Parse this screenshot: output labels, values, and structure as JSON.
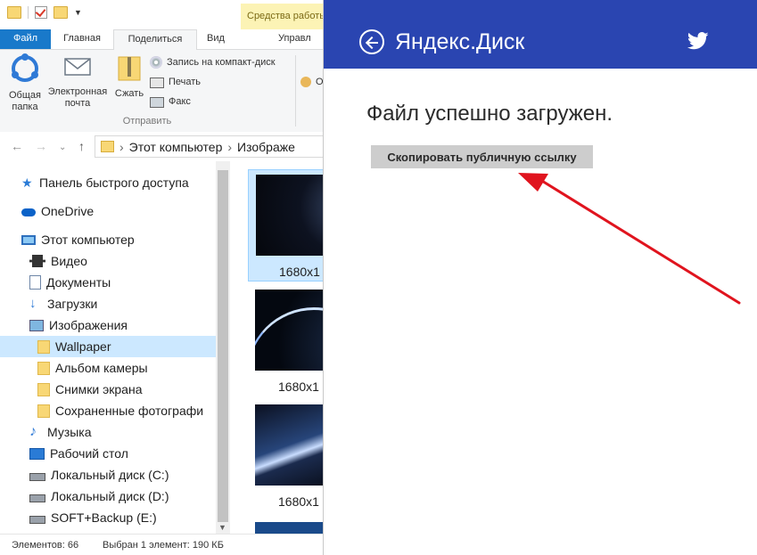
{
  "explorer": {
    "context_tab": "Средства работы",
    "tabs": {
      "file": "Файл",
      "home": "Главная",
      "share": "Поделиться",
      "view": "Вид",
      "manage": "Управл"
    },
    "ribbon": {
      "share_folder": "Общая папка",
      "email": "Электронная почта",
      "zip": "Сжать",
      "burn": "Запись на компакт-диск",
      "print": "Печать",
      "fax": "Факс",
      "group_label": "Отправить",
      "cut_label": "О"
    },
    "address": {
      "part1": "Этот компьютер",
      "sep": "›",
      "part2": "Изображе"
    },
    "tree": [
      "Панель быстрого доступа",
      "OneDrive",
      "Этот компьютер",
      "Видео",
      "Документы",
      "Загрузки",
      "Изображения",
      "Wallpaper",
      "Альбом камеры",
      "Снимки экрана",
      "Сохраненные фотографи",
      "Музыка",
      "Рабочий стол",
      "Локальный диск (C:)",
      "Локальный диск (D:)",
      "SOFT+Backup (E:)"
    ],
    "thumbs": [
      "1680x1",
      "1680x1",
      "1680x1"
    ],
    "status": {
      "items": "Элементов: 66",
      "selected": "Выбран 1 элемент: 190 КБ"
    }
  },
  "app": {
    "title": "Яндекс.Диск",
    "message": "Файл успешно загружен.",
    "copy_button": "Скопировать публичную ссылку",
    "colors": {
      "appbar": "#2a45b1",
      "arrow": "#e0141e"
    }
  }
}
